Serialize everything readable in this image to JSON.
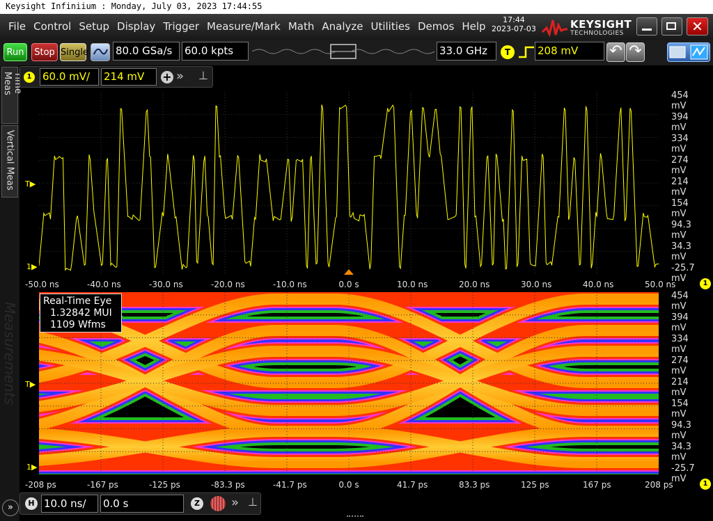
{
  "window": {
    "title": "Keysight Infiniium : Monday, July 03, 2023 17:44:55"
  },
  "menu": [
    "File",
    "Control",
    "Setup",
    "Display",
    "Trigger",
    "Measure/Mark",
    "Math",
    "Analyze",
    "Utilities",
    "Demos",
    "Help"
  ],
  "clock": {
    "time": "17:44",
    "date": "2023-07-03"
  },
  "brand": {
    "name": "KEYSIGHT",
    "sub": "TECHNOLOGIES"
  },
  "toolbar": {
    "run": "Run",
    "stop": "Stop",
    "single": "Single",
    "sample_rate": "80.0 GSa/s",
    "memory_depth": "60.0 kpts",
    "bandwidth": "33.0 GHz",
    "trigger_label": "T",
    "trigger_level": "208 mV"
  },
  "channel": {
    "number": "1",
    "scale": "60.0 mV/",
    "offset": "214 mV"
  },
  "side_tabs": [
    "Time Meas",
    "Vertical Meas",
    "Measurements"
  ],
  "upper_y_ticks": [
    "454 mV",
    "394 mV",
    "334 mV",
    "274 mV",
    "214 mV",
    "154 mV",
    "94.3 mV",
    "34.3 mV",
    "-25.7 mV"
  ],
  "upper_x_ticks": [
    "-50.0 ns",
    "-40.0 ns",
    "-30.0 ns",
    "-20.0 ns",
    "-10.0 ns",
    "0.0 s",
    "10.0 ns",
    "20.0 ns",
    "30.0 ns",
    "40.0 ns",
    "50.0 ns"
  ],
  "lower_y_ticks": [
    "454 mV",
    "394 mV",
    "334 mV",
    "274 mV",
    "214 mV",
    "154 mV",
    "94.3 mV",
    "34.3 mV",
    "-25.7 mV"
  ],
  "lower_x_ticks": [
    "-208 ps",
    "-167 ps",
    "-125 ps",
    "-83.3 ps",
    "-41.7 ps",
    "0.0 s",
    "41.7 ps",
    "83.3 ps",
    "125 ps",
    "167 ps",
    "208 ps"
  ],
  "eye": {
    "title": "Real-Time Eye",
    "mui": "1.32842 MUI",
    "wfms": "1109 Wfms"
  },
  "markers": {
    "trigger": "T",
    "ground": "1"
  },
  "horizontal": {
    "label": "H",
    "scale": "10.0 ns/",
    "position": "0.0 s",
    "zoom": "Z"
  },
  "colors": {
    "trace": "#ffff00",
    "accent_red": "#cc1111",
    "run_green": "#22aa22"
  }
}
